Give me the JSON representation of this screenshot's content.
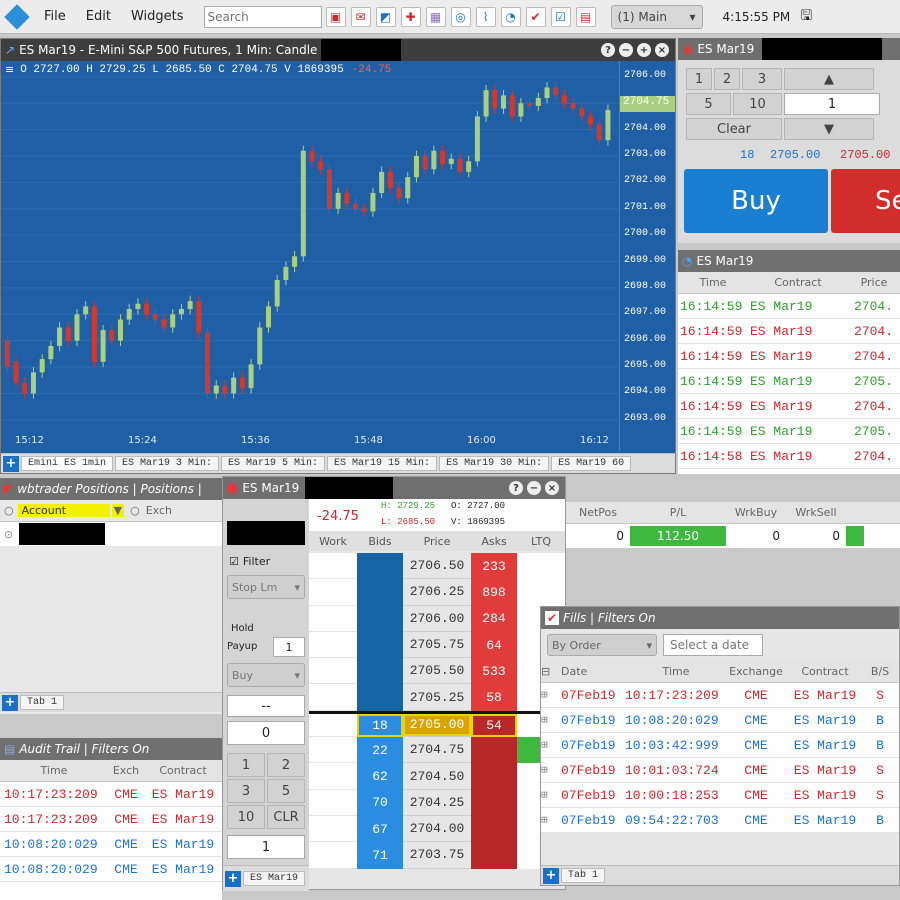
{
  "toolbar": {
    "file": "File",
    "edit": "Edit",
    "widgets": "Widgets",
    "search_placeholder": "Search",
    "workspace": "(1) Main",
    "clock": "4:15:55 PM"
  },
  "chart": {
    "title": "ES Mar19 - E-Mini S&P 500 Futures, 1 Min: Candle",
    "ohlc": "O 2727.00 H 2729.25 L 2685.50 C 2704.75 V 1869395",
    "change": "-24.75",
    "last": "2704.75",
    "price_labels": [
      "2706.00",
      "2705.00",
      "2704.00",
      "2703.00",
      "2702.00",
      "2701.00",
      "2700.00",
      "2699.00",
      "2698.00",
      "2697.00",
      "2696.00",
      "2695.00",
      "2694.00",
      "2693.00"
    ],
    "time_labels": [
      "15:12",
      "15:24",
      "15:36",
      "15:48",
      "16:00",
      "16:12"
    ],
    "tabs": [
      "Emini ES 1min",
      "ES Mar19 3 Min:",
      "ES Mar19 5 Min:",
      "ES Mar19 15 Min:",
      "ES Mar19 30 Min:",
      "ES Mar19 60"
    ],
    "colors": {
      "up": "#a8d080",
      "down": "#d03a2e",
      "bg": "#1f5fa5"
    }
  },
  "chart_data": {
    "type": "candlestick",
    "ylim": [
      2692.5,
      2706.3
    ],
    "x": [
      "15:12",
      "15:24",
      "15:36",
      "15:48",
      "16:00",
      "16:12"
    ],
    "candles": [
      [
        2696.0,
        2695.0
      ],
      [
        2695.2,
        2694.4
      ],
      [
        2694.4,
        2694.0
      ],
      [
        2694.0,
        2694.8
      ],
      [
        2694.8,
        2695.3
      ],
      [
        2695.3,
        2695.8
      ],
      [
        2695.8,
        2696.5
      ],
      [
        2696.5,
        2696.0
      ],
      [
        2696.0,
        2697.0
      ],
      [
        2697.0,
        2697.3
      ],
      [
        2697.3,
        2695.2
      ],
      [
        2695.2,
        2696.4
      ],
      [
        2696.4,
        2696.0
      ],
      [
        2696.0,
        2696.8
      ],
      [
        2696.8,
        2697.2
      ],
      [
        2697.2,
        2697.4
      ],
      [
        2697.4,
        2697.0
      ],
      [
        2697.0,
        2696.8
      ],
      [
        2696.8,
        2696.5
      ],
      [
        2696.5,
        2697.0
      ],
      [
        2697.0,
        2697.2
      ],
      [
        2697.2,
        2697.5
      ],
      [
        2697.5,
        2696.3
      ],
      [
        2696.3,
        2694.0
      ],
      [
        2694.0,
        2694.3
      ],
      [
        2694.3,
        2694.0
      ],
      [
        2694.0,
        2694.6
      ],
      [
        2694.6,
        2694.2
      ],
      [
        2694.2,
        2695.1
      ],
      [
        2695.1,
        2696.5
      ],
      [
        2696.5,
        2697.3
      ],
      [
        2697.3,
        2698.3
      ],
      [
        2698.3,
        2698.8
      ],
      [
        2698.8,
        2699.2
      ],
      [
        2699.2,
        2703.2
      ],
      [
        2703.2,
        2702.8
      ],
      [
        2702.8,
        2702.5
      ],
      [
        2702.5,
        2701.0
      ],
      [
        2701.0,
        2701.6
      ],
      [
        2701.6,
        2701.2
      ],
      [
        2701.2,
        2701.0
      ],
      [
        2701.0,
        2700.9
      ],
      [
        2700.9,
        2701.6
      ],
      [
        2701.6,
        2702.4
      ],
      [
        2702.4,
        2701.8
      ],
      [
        2701.8,
        2701.4
      ],
      [
        2701.4,
        2702.2
      ],
      [
        2702.2,
        2703.0
      ],
      [
        2703.0,
        2702.5
      ],
      [
        2702.5,
        2703.2
      ],
      [
        2703.2,
        2702.7
      ],
      [
        2702.7,
        2702.9
      ],
      [
        2702.9,
        2702.4
      ],
      [
        2702.4,
        2702.8
      ],
      [
        2702.8,
        2704.5
      ],
      [
        2704.5,
        2705.5
      ],
      [
        2705.5,
        2704.8
      ],
      [
        2704.8,
        2705.3
      ],
      [
        2705.3,
        2704.5
      ],
      [
        2704.5,
        2705.0
      ],
      [
        2705.0,
        2704.9
      ],
      [
        2704.9,
        2705.2
      ],
      [
        2705.2,
        2705.6
      ],
      [
        2705.6,
        2705.3
      ],
      [
        2705.3,
        2705.0
      ],
      [
        2705.0,
        2704.8
      ],
      [
        2704.8,
        2704.5
      ],
      [
        2704.5,
        2704.2
      ],
      [
        2704.2,
        2703.6
      ],
      [
        2703.6,
        2704.75
      ]
    ]
  },
  "order_ticket": {
    "title": "ES Mar19",
    "keys": [
      "1",
      "2",
      "3",
      "5",
      "10"
    ],
    "qty": "1",
    "clear": "Clear",
    "bid_qty": "18",
    "bid": "2705.00",
    "ask": "2705.00",
    "buy": "Buy",
    "sell": "Se"
  },
  "tas": {
    "title": "ES Mar19",
    "cols": [
      "Time",
      "Contract",
      "Price"
    ],
    "rows": [
      {
        "time": "16:14:59",
        "contract": "ES Mar19",
        "price": "2704.",
        "c": "g"
      },
      {
        "time": "16:14:59",
        "contract": "ES Mar19",
        "price": "2704.",
        "c": "r"
      },
      {
        "time": "16:14:59",
        "contract": "ES Mar19",
        "price": "2704.",
        "c": "r"
      },
      {
        "time": "16:14:59",
        "contract": "ES Mar19",
        "price": "2705.",
        "c": "g"
      },
      {
        "time": "16:14:59",
        "contract": "ES Mar19",
        "price": "2704.",
        "c": "r"
      },
      {
        "time": "16:14:59",
        "contract": "ES Mar19",
        "price": "2705.",
        "c": "g"
      },
      {
        "time": "16:14:58",
        "contract": "ES Mar19",
        "price": "2704.",
        "c": "r"
      }
    ]
  },
  "positions": {
    "title": "wbtrader Positions | Positions |",
    "account": "Account",
    "exch": "Exch",
    "tab": "Tab 1",
    "cols": [
      "NetPos",
      "P/L",
      "WrkBuy",
      "WrkSell"
    ],
    "netpos": "0",
    "pl": "112.50",
    "wrkbuy": "0",
    "wrksell": "0"
  },
  "dom": {
    "title": "ES Mar19",
    "change": "-24.75",
    "h": "H: 2729.25",
    "l": "L: 2685.50",
    "o": "O: 2727.00",
    "v": "V: 1869395",
    "filter": "Filter",
    "order_type": "Stop Lm",
    "hold": "Hold",
    "payup": "Payup",
    "payup_val": "1",
    "side": "Buy",
    "offset": "--",
    "offset_val": "0",
    "keys": [
      "1",
      "2",
      "3",
      "5",
      "10",
      "CLR"
    ],
    "qty": "1",
    "cols": [
      "Work",
      "Bids",
      "Price",
      "Asks",
      "LTQ"
    ],
    "rows": [
      {
        "bid": "",
        "price": "2706.50",
        "ask": "233"
      },
      {
        "bid": "",
        "price": "2706.25",
        "ask": "898"
      },
      {
        "bid": "",
        "price": "2706.00",
        "ask": "284"
      },
      {
        "bid": "",
        "price": "2705.75",
        "ask": "64"
      },
      {
        "bid": "",
        "price": "2705.50",
        "ask": "533"
      },
      {
        "bid": "",
        "price": "2705.25",
        "ask": "58"
      },
      {
        "bid": "18",
        "price": "2705.00",
        "ask": "54"
      },
      {
        "bid": "22",
        "price": "2704.75",
        "ask": ""
      },
      {
        "bid": "62",
        "price": "2704.50",
        "ask": ""
      },
      {
        "bid": "70",
        "price": "2704.25",
        "ask": ""
      },
      {
        "bid": "67",
        "price": "2704.00",
        "ask": ""
      },
      {
        "bid": "71",
        "price": "2703.75",
        "ask": ""
      }
    ],
    "tab": "ES Mar19"
  },
  "fills": {
    "title": "Fills | Filters On",
    "group": "By Order",
    "date_placeholder": "Select a date",
    "cols": [
      "Date",
      "Time",
      "Exchange",
      "Contract",
      "B/S"
    ],
    "tab": "Tab 1",
    "rows": [
      {
        "date": "07Feb19",
        "time": "10:17:23:209",
        "exch": "CME",
        "contract": "ES Mar19",
        "bs": "S",
        "c": "r"
      },
      {
        "date": "07Feb19",
        "time": "10:08:20:029",
        "exch": "CME",
        "contract": "ES Mar19",
        "bs": "B",
        "c": "b"
      },
      {
        "date": "07Feb19",
        "time": "10:03:42:999",
        "exch": "CME",
        "contract": "ES Mar19",
        "bs": "B",
        "c": "b"
      },
      {
        "date": "07Feb19",
        "time": "10:01:03:724",
        "exch": "CME",
        "contract": "ES Mar19",
        "bs": "S",
        "c": "r"
      },
      {
        "date": "07Feb19",
        "time": "10:00:18:253",
        "exch": "CME",
        "contract": "ES Mar19",
        "bs": "S",
        "c": "r"
      },
      {
        "date": "07Feb19",
        "time": "09:54:22:703",
        "exch": "CME",
        "contract": "ES Mar19",
        "bs": "B",
        "c": "b"
      }
    ]
  },
  "audit": {
    "title": "Audit Trail | Filters On",
    "cols": [
      "Time",
      "Exch",
      "Contract"
    ],
    "rows": [
      {
        "time": "10:17:23:209",
        "exch": "CME",
        "contract": "ES Mar19",
        "c": "r"
      },
      {
        "time": "10:17:23:209",
        "exch": "CME",
        "contract": "ES Mar19",
        "c": "r"
      },
      {
        "time": "10:08:20:029",
        "exch": "CME",
        "contract": "ES Mar19",
        "c": "b"
      },
      {
        "time": "10:08:20:029",
        "exch": "CME",
        "contract": "ES Mar19",
        "c": "b"
      }
    ]
  }
}
